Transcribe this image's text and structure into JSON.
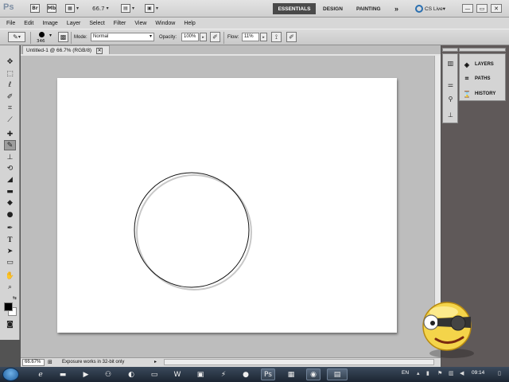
{
  "appbar": {
    "logo": "Ps",
    "mb_label": "Mb",
    "zoom_value": "66.7",
    "workspaces": [
      "ESSENTIALS",
      "DESIGN",
      "PAINTING"
    ],
    "more": "»",
    "cs_live": "CS Live",
    "cs_live_arrow": "▾",
    "window_buttons": [
      "—",
      "▭",
      "✕"
    ]
  },
  "menubar": {
    "items": [
      "File",
      "Edit",
      "Image",
      "Layer",
      "Select",
      "Filter",
      "View",
      "Window",
      "Help"
    ]
  },
  "optbar": {
    "brush_size": "346",
    "mode_label": "Mode:",
    "mode_value": "Normal",
    "opacity_label": "Opacity:",
    "opacity_value": "100%",
    "flow_label": "Flow:",
    "flow_value": "11%"
  },
  "document": {
    "tab_title": "Untitled-1 @ 66.7% (RGB/8)",
    "tab_close": "✕"
  },
  "status": {
    "zoom": "66.67%",
    "message": "Exposure works in 32-bit only",
    "arrow": "▸"
  },
  "panels": {
    "items": [
      "LAYERS",
      "PATHS",
      "HISTORY"
    ]
  },
  "taskbar": {
    "lang": "EN",
    "time": "09:14"
  },
  "colors": {
    "workspace_active_bg": "#4a4a4a",
    "canvas": "#ffffff",
    "pasteboard": "#bdbdbd",
    "taskbar": "#1c2532"
  },
  "icons": {
    "tools": [
      "move-icon",
      "marquee-icon",
      "lasso-icon",
      "quick-select-icon",
      "crop-icon",
      "eyedropper-icon",
      "spot-healing-icon",
      "brush-icon",
      "clone-stamp-icon",
      "history-brush-icon",
      "eraser-icon",
      "gradient-icon",
      "blur-icon",
      "dodge-icon",
      "pen-icon",
      "type-icon",
      "path-select-icon",
      "shape-icon",
      "hand-icon",
      "zoom-icon"
    ]
  }
}
